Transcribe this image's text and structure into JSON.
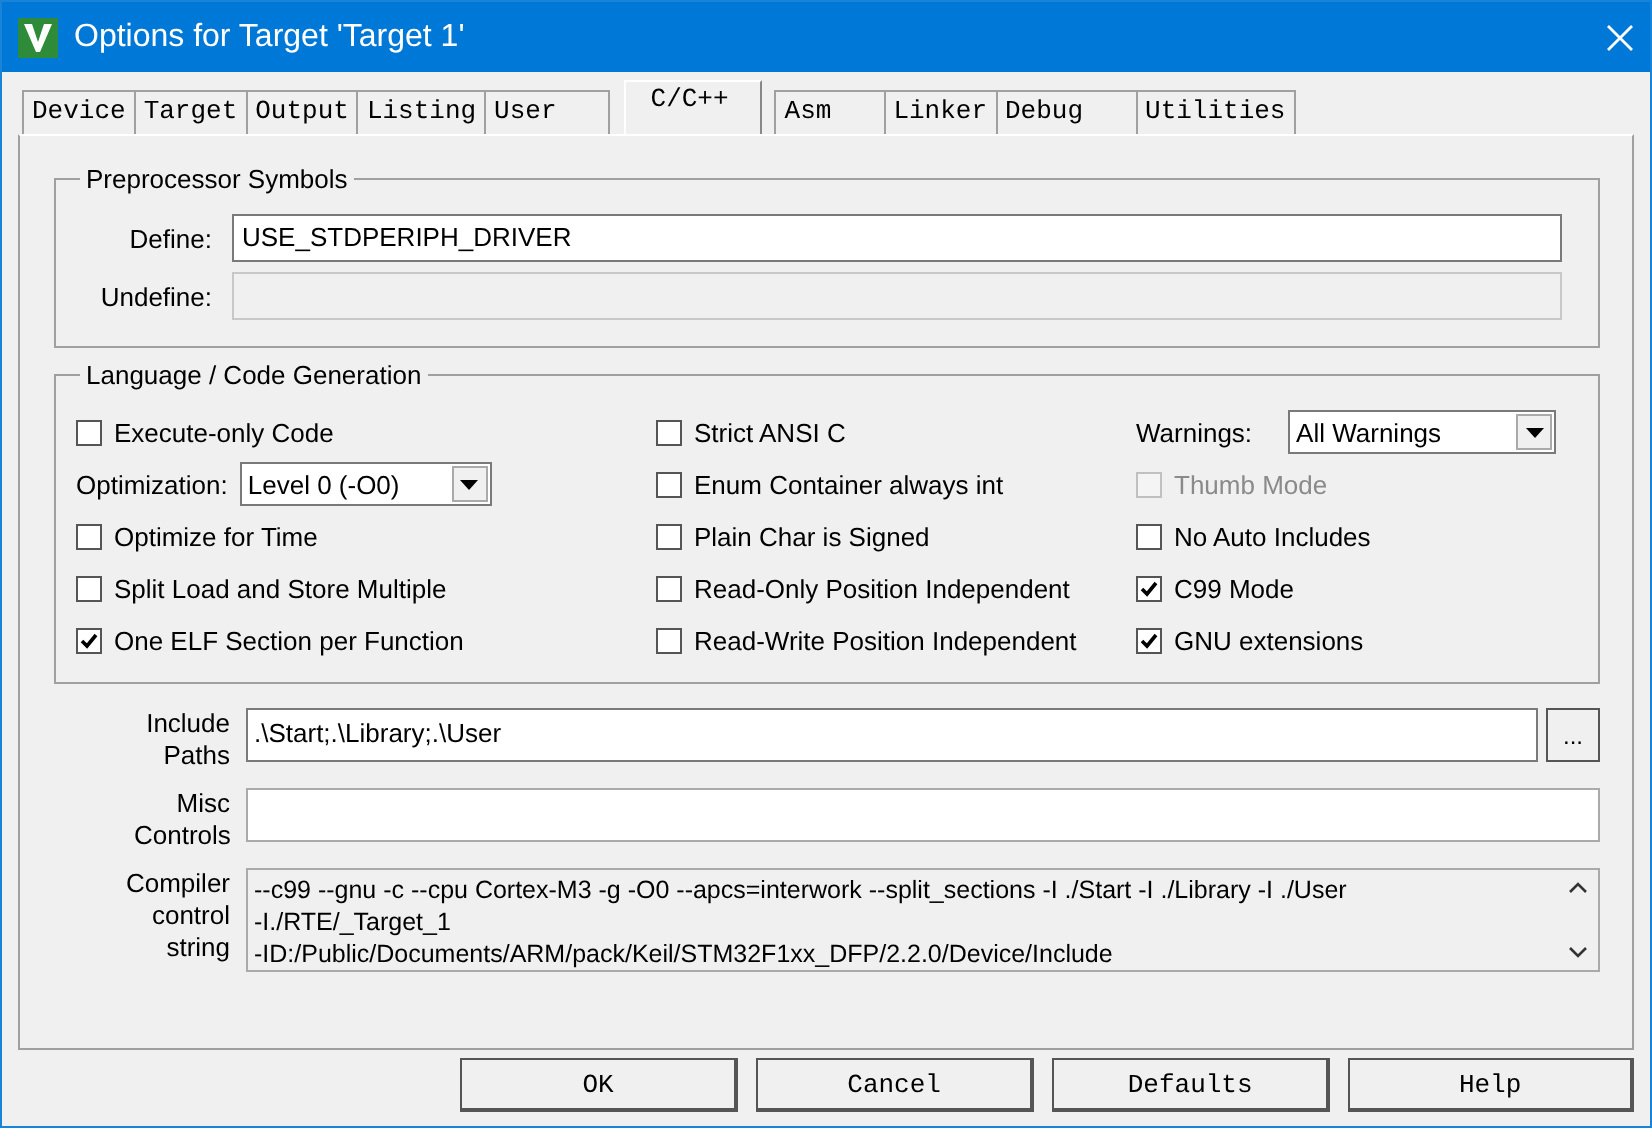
{
  "window": {
    "title": "Options for Target 'Target 1'"
  },
  "tabs": [
    {
      "label": "Device",
      "selected": false
    },
    {
      "label": "Target",
      "selected": false
    },
    {
      "label": "Output",
      "selected": false
    },
    {
      "label": "Listing",
      "selected": false
    },
    {
      "label": "User",
      "selected": false
    },
    {
      "label": "C/C++",
      "selected": true
    },
    {
      "label": "Asm",
      "selected": false
    },
    {
      "label": "Linker",
      "selected": false
    },
    {
      "label": "Debug",
      "selected": false
    },
    {
      "label": "Utilities",
      "selected": false
    }
  ],
  "preprocessor": {
    "title": "Preprocessor Symbols",
    "fields": [
      {
        "label": "Define:",
        "value": "USE_STDPERIPH_DRIVER",
        "disabled": false
      },
      {
        "label": "Undefine:",
        "disabled": true
      }
    ]
  },
  "language": {
    "title": "Language / Code Generation",
    "columns": [
      [
        {
          "kind": "checkbox",
          "label": "Execute-only Code",
          "checked": false,
          "disabled": false
        },
        {
          "kind": "select",
          "label": "Optimization:",
          "value": "Level 0 (-O0)"
        },
        {
          "kind": "checkbox",
          "label": "Optimize for Time",
          "checked": false,
          "disabled": false
        },
        {
          "kind": "checkbox",
          "label": "Split Load and Store Multiple",
          "checked": false,
          "disabled": false
        },
        {
          "kind": "checkbox",
          "label": "One ELF Section per Function",
          "checked": true,
          "disabled": false
        }
      ],
      [
        {
          "kind": "checkbox",
          "label": "Strict ANSI C",
          "checked": false,
          "disabled": false
        },
        {
          "kind": "checkbox",
          "label": "Enum Container always int",
          "checked": false,
          "disabled": false
        },
        {
          "kind": "checkbox",
          "label": "Plain Char is Signed",
          "checked": false,
          "disabled": false
        },
        {
          "kind": "checkbox",
          "label": "Read-Only Position Independent",
          "checked": false,
          "disabled": false
        },
        {
          "kind": "checkbox",
          "label": "Read-Write Position Independent",
          "checked": false,
          "disabled": false
        }
      ],
      [
        {
          "kind": "select",
          "label": "Warnings:",
          "value": "All Warnings"
        },
        {
          "kind": "checkbox",
          "label": "Thumb Mode",
          "checked": false,
          "disabled": true
        },
        {
          "kind": "checkbox",
          "label": "No Auto Includes",
          "checked": false,
          "disabled": false
        },
        {
          "kind": "checkbox",
          "label": "C99 Mode",
          "checked": true,
          "disabled": false
        },
        {
          "kind": "checkbox",
          "label": "GNU extensions",
          "checked": true,
          "disabled": false
        }
      ]
    ]
  },
  "include_paths": {
    "label": "Include Paths",
    "value": ".\\Start;.\\Library;.\\User",
    "browse": "..."
  },
  "misc_controls": {
    "label": "Misc Controls"
  },
  "compiler_control_string": {
    "label": "Compiler control string",
    "lines": [
      "--c99 --gnu -c --cpu Cortex-M3 -g -O0 --apcs=interwork --split_sections -I ./Start -I ./Library -I ./User",
      "-I./RTE/_Target_1",
      "-ID:/Public/Documents/ARM/pack/Keil/STM32F1xx_DFP/2.2.0/Device/Include"
    ]
  },
  "buttons": [
    "OK",
    "Cancel",
    "Defaults",
    "Help"
  ]
}
